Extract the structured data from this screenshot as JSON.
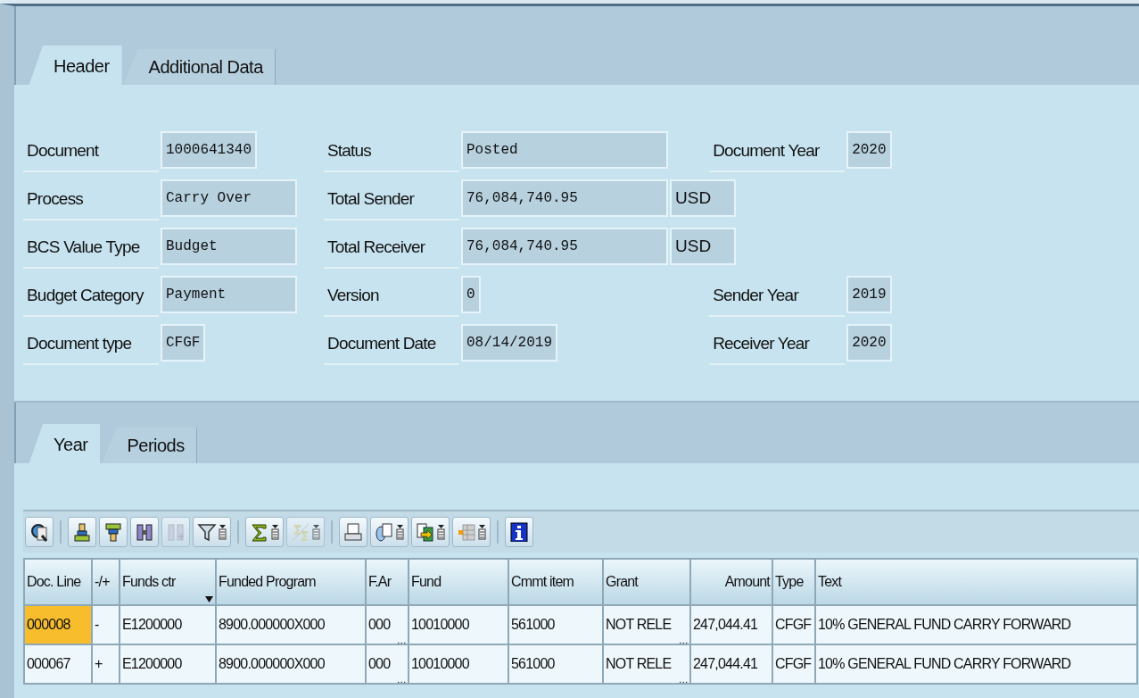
{
  "header_tabs": [
    {
      "label": "Header",
      "selected": true
    },
    {
      "label": "Additional Data",
      "selected": false
    }
  ],
  "form": {
    "left": [
      {
        "label": "Document",
        "value": "1000641340"
      },
      {
        "label": "Process",
        "value": "Carry Over"
      },
      {
        "label": "BCS Value Type",
        "value": "Budget"
      },
      {
        "label": "Budget Category",
        "value": "Payment"
      },
      {
        "label": "Document type",
        "value": "CFGF"
      }
    ],
    "middle": [
      {
        "label": "Status",
        "value": "Posted"
      },
      {
        "label": "Total Sender",
        "value": "76,084,740.95",
        "unit": "USD"
      },
      {
        "label": "Total Receiver",
        "value": "76,084,740.95",
        "unit": "USD"
      },
      {
        "label": "Version",
        "value": "0"
      },
      {
        "label": "Document Date",
        "value": "08/14/2019"
      }
    ],
    "right": [
      {
        "label": "Document Year",
        "value": "2020"
      },
      {
        "kind": "blank"
      },
      {
        "kind": "blank"
      },
      {
        "label": "Sender Year",
        "value": "2019"
      },
      {
        "label": "Receiver Year",
        "value": "2020"
      }
    ]
  },
  "item_tabs": [
    {
      "label": "Year",
      "selected": true
    },
    {
      "label": "Periods",
      "selected": false
    }
  ],
  "toolbar": [
    [
      {
        "kind": "details",
        "disabled": false,
        "dropdown": false
      }
    ],
    [
      {
        "kind": "sort-up",
        "disabled": false,
        "dropdown": false
      },
      {
        "kind": "sort-down",
        "disabled": false,
        "dropdown": false
      },
      {
        "kind": "find",
        "disabled": false,
        "dropdown": false
      },
      {
        "kind": "find-next",
        "disabled": true,
        "dropdown": false
      },
      {
        "kind": "filter",
        "disabled": false,
        "dropdown": true
      }
    ],
    [
      {
        "kind": "sum",
        "disabled": false,
        "dropdown": true
      },
      {
        "kind": "subtotal",
        "disabled": true,
        "dropdown": true
      }
    ],
    [
      {
        "kind": "print",
        "disabled": false,
        "dropdown": false
      },
      {
        "kind": "views",
        "disabled": false,
        "dropdown": true
      },
      {
        "kind": "export",
        "disabled": false,
        "dropdown": true
      },
      {
        "kind": "layout",
        "disabled": false,
        "dropdown": true
      }
    ],
    [
      {
        "kind": "info",
        "disabled": false,
        "dropdown": false
      }
    ]
  ],
  "table": {
    "columns": [
      {
        "label": "Doc. Line",
        "sorted": false
      },
      {
        "label": "-/+",
        "sorted": false
      },
      {
        "label": "Funds ctr",
        "sorted": true
      },
      {
        "label": "Funded Program",
        "sorted": false
      },
      {
        "label": "F.Ar",
        "sorted": false
      },
      {
        "label": "Fund",
        "sorted": false
      },
      {
        "label": "Cmmt item",
        "sorted": false
      },
      {
        "label": "Grant",
        "sorted": false
      },
      {
        "label": "Amount",
        "sorted": false,
        "kind": "amount"
      },
      {
        "label": "Type",
        "sorted": false
      },
      {
        "label": "Text",
        "sorted": false
      }
    ],
    "rows": [
      {
        "focused": true,
        "cells": [
          "000008",
          "-",
          "E1200000",
          "8900.000000X000",
          {
            "text": "000",
            "more": "…"
          },
          "10010000",
          "561000",
          {
            "text": "NOT RELE",
            "more": "…"
          },
          "247,044.41",
          "CFGF",
          "10% GENERAL FUND CARRY FORWARD"
        ]
      },
      {
        "focused": false,
        "cells": [
          "000067",
          "+",
          "E1200000",
          "8900.000000X000",
          {
            "text": "000",
            "more": "…"
          },
          "10010000",
          "561000",
          {
            "text": "NOT RELE",
            "more": "…"
          },
          "247,044.41",
          "CFGF",
          "10% GENERAL FUND CARRY FORWARD"
        ]
      }
    ]
  }
}
